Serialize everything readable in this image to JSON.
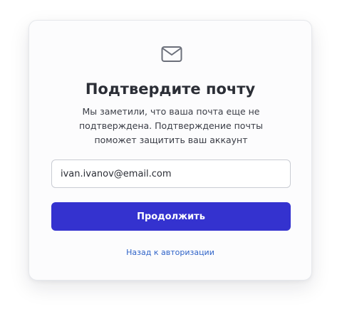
{
  "icons": {
    "mail": "mail-icon"
  },
  "colors": {
    "primary": "#3432cf",
    "link": "#2f63c8",
    "title": "#2b2e36",
    "text": "#3a3d46"
  },
  "card": {
    "title": "Подтвердите почту",
    "subtitle": "Мы заметили, что ваша почта еще не подтверждена. Подтверждение почты поможет защитить ваш аккаунт",
    "email_value": "ivan.ivanov@email.com",
    "continue_label": "Продолжить",
    "back_link": "Назад к авторизации"
  }
}
